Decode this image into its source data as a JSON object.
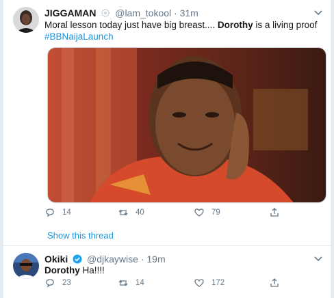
{
  "tweets": [
    {
      "name": "JIGGAMAN",
      "handle": "@lam_tokool",
      "separator": "·",
      "time": "31m",
      "text_plain": "Moral lesson today just have big breast.... ",
      "text_bold": "Dorothy",
      "text_after": " is a living proof",
      "hashtag": "#BBNaijaLaunch",
      "replies": "14",
      "retweets": "40",
      "likes": "79"
    },
    {
      "name": "Okiki",
      "handle": "@djkaywise",
      "separator": "·",
      "time": "19m",
      "text_bold": "Dorothy",
      "text_after": " Ha!!!!",
      "replies": "23",
      "retweets": "14",
      "likes": "172"
    }
  ],
  "show_thread_label": "Show this thread",
  "colors": {
    "link": "#1b95e0",
    "muted": "#657786",
    "verified": "#1da1f2"
  },
  "icons": [
    "more-chevron-icon",
    "reply-icon",
    "retweet-icon",
    "like-icon",
    "share-icon",
    "verified-badge-icon",
    "wreath-badge-icon"
  ]
}
